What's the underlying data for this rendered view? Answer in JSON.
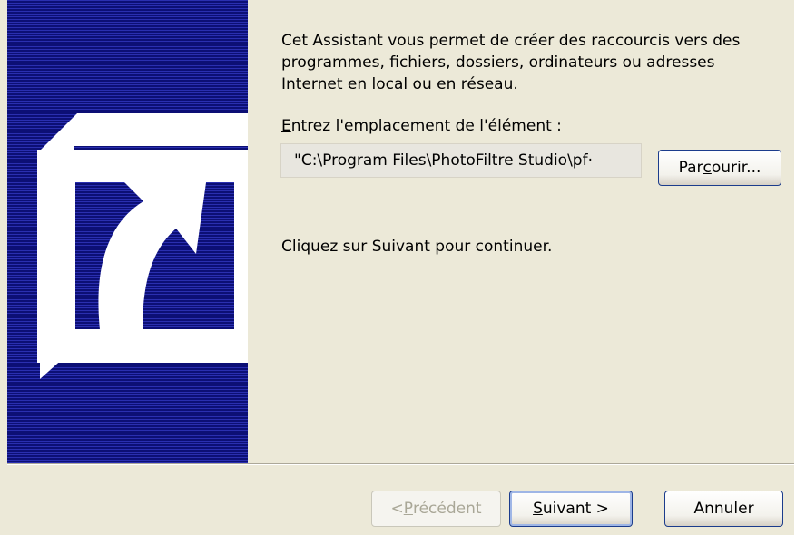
{
  "wizard": {
    "description": "Cet Assistant vous permet de créer des raccourcis vers des programmes, fichiers, dossiers, ordinateurs ou adresses Internet en local ou en réseau.",
    "location_label_accel": "E",
    "location_label_rest": "ntrez l'emplacement de l'élément :",
    "location_value": "\"C:\\Program Files\\PhotoFiltre Studio\\pf·",
    "browse_button": {
      "pre": "Par",
      "accel": "c",
      "post": "ourir..."
    },
    "hint": "Cliquez sur Suivant pour continuer."
  },
  "buttons": {
    "previous": {
      "pre": "< ",
      "accel": "P",
      "post": "récédent"
    },
    "next": {
      "accel": "S",
      "post": "uivant >"
    },
    "cancel": "Annuler"
  },
  "icons": {
    "banner": "shortcut-arrow-icon"
  },
  "colors": {
    "banner": "#12168a",
    "dialog": "#ece9d8",
    "button_border": "#1b3c8c"
  }
}
